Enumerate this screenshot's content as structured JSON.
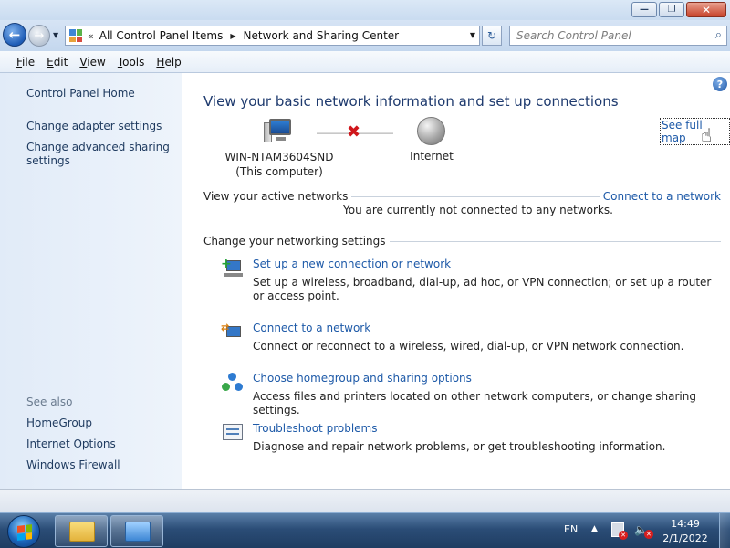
{
  "window": {
    "minimize_glyph": "—",
    "maximize_glyph": "❐",
    "close_glyph": "✕"
  },
  "nav": {
    "back_glyph": "←",
    "forward_glyph": "→",
    "history_dropdown_glyph": "▼",
    "breadcrumb_overflow": "«",
    "breadcrumb": [
      "All Control Panel Items",
      "Network and Sharing Center"
    ],
    "breadcrumb_separator": "▶",
    "address_dropdown_glyph": "▼",
    "refresh_glyph": "↻",
    "search_placeholder": "Search Control Panel",
    "search_icon_glyph": "⌕"
  },
  "menubar": {
    "items": [
      {
        "u": "F",
        "rest": "ile"
      },
      {
        "u": "E",
        "rest": "dit"
      },
      {
        "u": "V",
        "rest": "iew"
      },
      {
        "u": "T",
        "rest": "ools"
      },
      {
        "u": "H",
        "rest": "elp"
      }
    ]
  },
  "sidebar": {
    "home": "Control Panel Home",
    "links": [
      "Change adapter settings",
      "Change advanced sharing settings"
    ],
    "see_also_label": "See also",
    "see_also": [
      "HomeGroup",
      "Internet Options",
      "Windows Firewall"
    ]
  },
  "main": {
    "help_glyph": "?",
    "heading": "View your basic network information and set up connections",
    "see_full_map": "See full map",
    "cursor_glyph": "☝",
    "map": {
      "computer_name": "WIN-NTAM3604SND",
      "computer_caption": "(This computer)",
      "link_status_glyph": "✖",
      "internet_label": "Internet"
    },
    "active_networks": {
      "label": "View your active networks",
      "link": "Connect to a network",
      "status": "You are currently not connected to any networks."
    },
    "settings_label": "Change your networking settings",
    "tasks": [
      {
        "title": "Set up a new connection or network",
        "desc": "Set up a wireless, broadband, dial-up, ad hoc, or VPN connection; or set up a router or access point."
      },
      {
        "title": "Connect to a network",
        "desc": "Connect or reconnect to a wireless, wired, dial-up, or VPN network connection."
      },
      {
        "title": "Choose homegroup and sharing options",
        "desc": "Access files and printers located on other network computers, or change sharing settings."
      },
      {
        "title": "Troubleshoot problems",
        "desc": "Diagnose and repair network problems, or get troubleshooting information."
      }
    ],
    "icons": {
      "setup_plus": "+",
      "connect_arrows": "⇄"
    }
  },
  "taskbar": {
    "language": "EN",
    "tray_expand_glyph": "▲",
    "volume_glyph": "🔈",
    "tray_error_glyph": "✕",
    "time": "14:49",
    "date": "2/1/2022"
  },
  "colors": {
    "link": "#1e5aa8",
    "heading": "#1e3a6e",
    "error": "#d0161b",
    "sidebar": "#e1ebf8",
    "taskbar": "#2b4d77"
  }
}
